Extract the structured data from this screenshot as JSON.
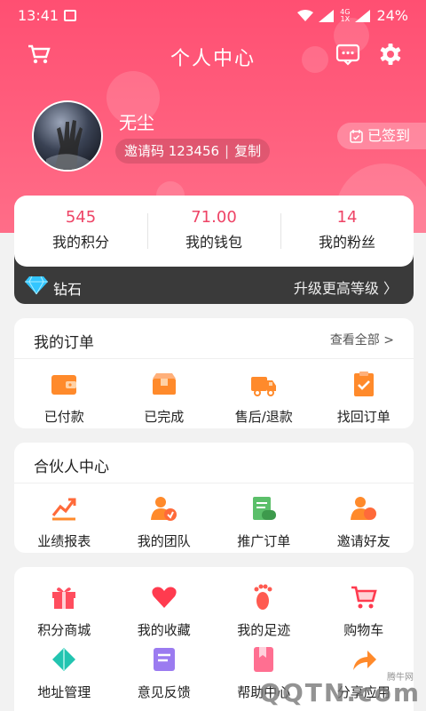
{
  "status_bar": {
    "time": "13:41",
    "network": "4G",
    "network_sub": "1X",
    "battery": "24%"
  },
  "header": {
    "title": "个人中心"
  },
  "profile": {
    "name": "无尘",
    "invite_label": "邀请码 123456",
    "separator": "|",
    "copy_label": "复制",
    "signin_label": "已签到"
  },
  "stats": [
    {
      "value": "545",
      "label": "我的积分"
    },
    {
      "value": "71.00",
      "label": "我的钱包"
    },
    {
      "value": "14",
      "label": "我的粉丝"
    }
  ],
  "vip": {
    "level": "钻石",
    "upgrade_label": "升级更高等级"
  },
  "orders": {
    "title": "我的订单",
    "view_all": "查看全部 >",
    "items": [
      {
        "label": "已付款",
        "icon": "wallet-icon"
      },
      {
        "label": "已完成",
        "icon": "box-icon"
      },
      {
        "label": "售后/退款",
        "icon": "truck-icon"
      },
      {
        "label": "找回订单",
        "icon": "clipboard-check-icon"
      }
    ]
  },
  "partner": {
    "title": "合伙人中心",
    "items": [
      {
        "label": "业绩报表",
        "icon": "chart-icon"
      },
      {
        "label": "我的团队",
        "icon": "team-icon"
      },
      {
        "label": "推广订单",
        "icon": "promo-order-icon"
      },
      {
        "label": "邀请好友",
        "icon": "invite-friend-icon"
      }
    ]
  },
  "tools": {
    "items": [
      {
        "label": "积分商城",
        "icon": "gift-icon"
      },
      {
        "label": "我的收藏",
        "icon": "heart-icon"
      },
      {
        "label": "我的足迹",
        "icon": "footprint-icon"
      },
      {
        "label": "购物车",
        "icon": "cart-icon"
      },
      {
        "label": "地址管理",
        "icon": "map-icon"
      },
      {
        "label": "意见反馈",
        "icon": "feedback-icon"
      },
      {
        "label": "帮助中心",
        "icon": "bookmark-icon"
      },
      {
        "label": "分享应用",
        "icon": "share-icon"
      }
    ]
  },
  "colors": {
    "brand": "#ff5a7a",
    "accent_text": "#ee4466",
    "vip_bar": "#3a3a3a",
    "icon_orange": "#ff8a2b"
  },
  "watermark": {
    "text": "QQTN.com",
    "small": "腾牛网"
  }
}
